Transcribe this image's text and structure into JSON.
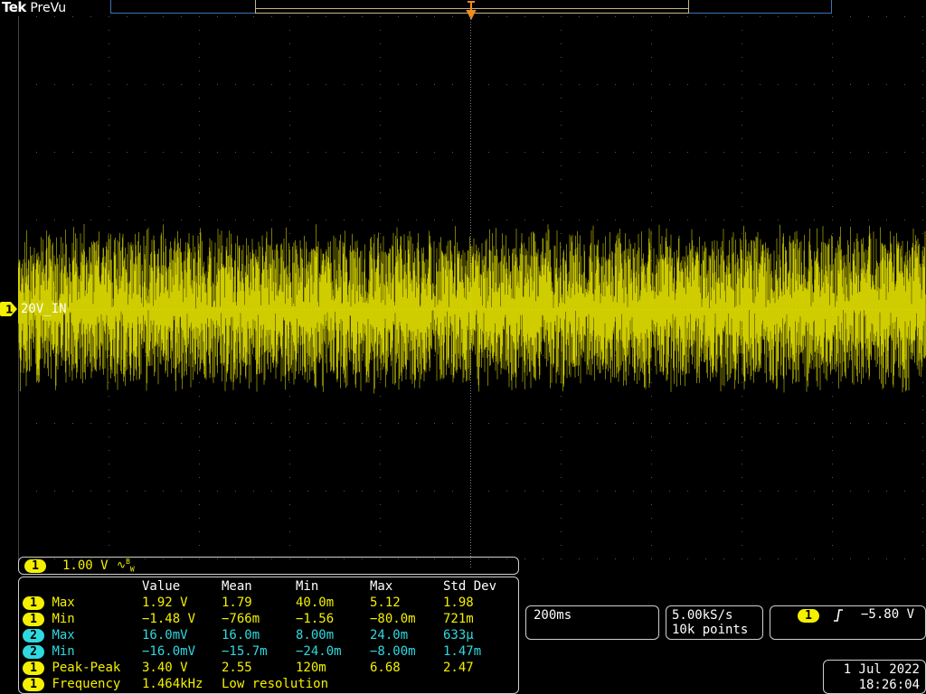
{
  "header": {
    "brand": "Tek",
    "mode": "PreVu"
  },
  "channel1": {
    "label": "20V_IN",
    "number": "1",
    "scale": "1.00 V",
    "bandwidth_icon": "bandwidth-limit-icon",
    "color": "#f4f000"
  },
  "measurements": {
    "columns": [
      "",
      "Value",
      "Mean",
      "Min",
      "Max",
      "Std Dev"
    ],
    "rows": [
      {
        "ch": "1",
        "name": "Max",
        "value": "1.92 V",
        "mean": "1.79",
        "min": "40.0m",
        "max": "5.12",
        "std": "1.98",
        "color": "yellow"
      },
      {
        "ch": "1",
        "name": "Min",
        "value": "−1.48 V",
        "mean": "−766m",
        "min": "−1.56",
        "max": "−80.0m",
        "std": "721m",
        "color": "yellow"
      },
      {
        "ch": "2",
        "name": "Max",
        "value": "16.0mV",
        "mean": "16.0m",
        "min": "8.00m",
        "max": "24.0m",
        "std": "633μ",
        "color": "cyan"
      },
      {
        "ch": "2",
        "name": "Min",
        "value": "−16.0mV",
        "mean": "−15.7m",
        "min": "−24.0m",
        "max": "−8.00m",
        "std": "1.47m",
        "color": "cyan"
      },
      {
        "ch": "1",
        "name": "Peak-Peak",
        "value": "3.40 V",
        "mean": "2.55",
        "min": "120m",
        "max": "6.68",
        "std": "2.47",
        "color": "yellow"
      },
      {
        "ch": "1",
        "name": "Frequency",
        "value": "1.464kHz",
        "mean": "Low resolution",
        "min": "",
        "max": "",
        "std": "",
        "color": "yellow"
      }
    ]
  },
  "timebase": {
    "scale": "200ms",
    "sample_rate": "5.00kS/s",
    "record_length": "10k points"
  },
  "trigger": {
    "source": "1",
    "slope_icon": "rising-edge-icon",
    "level": "−5.80 V"
  },
  "datetime": {
    "date": "1 Jul  2022",
    "time": "18:26:04"
  },
  "colors": {
    "ch1": "#f4f000",
    "ch2": "#2fd9e0",
    "record_bar": "#3a74b8",
    "trigger_marker": "#f08c1c"
  }
}
